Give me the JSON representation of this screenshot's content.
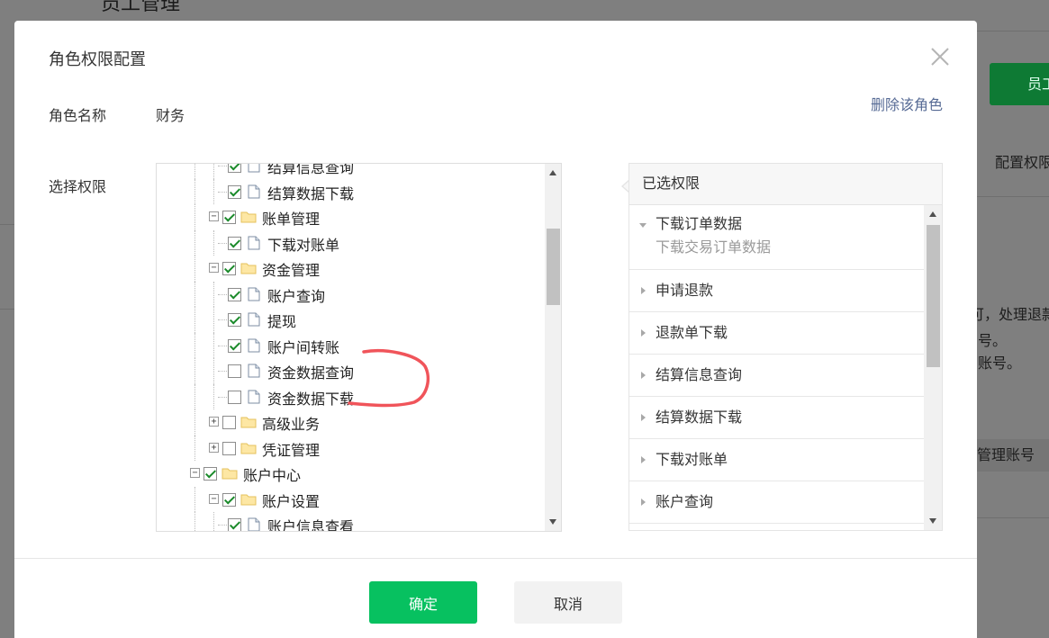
{
  "background": {
    "title": "员工管理",
    "button_label": "员工",
    "tab_label": "配置权限",
    "notice_line1": "可，处理退款",
    "notice_line2": "号。",
    "notice_line3": "账号。",
    "table_cell": "管理账号"
  },
  "dialog": {
    "title": "角色权限配置",
    "role_name_label": "角色名称",
    "role_name_value": "财务",
    "delete_role": "删除该角色",
    "select_permission_label": "选择权限",
    "confirm_label": "确定",
    "cancel_label": "取消"
  },
  "tree": {
    "nodes": [
      {
        "label": "结算信息查询",
        "level": 2,
        "type": "leaf",
        "checked": true
      },
      {
        "label": "结算数据下载",
        "level": 2,
        "type": "leaf",
        "checked": true
      },
      {
        "label": "账单管理",
        "level": 1,
        "type": "folder",
        "checked": true,
        "expanded": true
      },
      {
        "label": "下载对账单",
        "level": 2,
        "type": "leaf",
        "checked": true
      },
      {
        "label": "资金管理",
        "level": 1,
        "type": "folder",
        "checked": true,
        "expanded": true
      },
      {
        "label": "账户查询",
        "level": 2,
        "type": "leaf",
        "checked": true
      },
      {
        "label": "提现",
        "level": 2,
        "type": "leaf",
        "checked": true
      },
      {
        "label": "账户间转账",
        "level": 2,
        "type": "leaf",
        "checked": true
      },
      {
        "label": "资金数据查询",
        "level": 2,
        "type": "leaf",
        "checked": false
      },
      {
        "label": "资金数据下载",
        "level": 2,
        "type": "leaf",
        "checked": false
      },
      {
        "label": "高级业务",
        "level": 1,
        "type": "folder",
        "checked": false,
        "expanded": false
      },
      {
        "label": "凭证管理",
        "level": 1,
        "type": "folder",
        "checked": false,
        "expanded": false
      },
      {
        "label": "账户中心",
        "level": 0,
        "type": "folder",
        "checked": true,
        "expanded": true
      },
      {
        "label": "账户设置",
        "level": 1,
        "type": "folder",
        "checked": true,
        "expanded": true
      },
      {
        "label": "账户信息查看",
        "level": 2,
        "type": "leaf",
        "checked": true
      }
    ]
  },
  "selected": {
    "header": "已选权限",
    "items": [
      {
        "name": "下载订单数据",
        "desc": "下载交易订单数据",
        "open": true
      },
      {
        "name": "申请退款",
        "desc": "",
        "open": false
      },
      {
        "name": "退款单下载",
        "desc": "",
        "open": false
      },
      {
        "name": "结算信息查询",
        "desc": "",
        "open": false
      },
      {
        "name": "结算数据下载",
        "desc": "",
        "open": false
      },
      {
        "name": "下载对账单",
        "desc": "",
        "open": false
      },
      {
        "name": "账户查询",
        "desc": "",
        "open": false
      }
    ]
  },
  "colors": {
    "primary_green": "#07c160",
    "link_blue": "#576b95",
    "annotation_red": "#f0545a"
  },
  "icons": {
    "close": "close-icon",
    "folder": "folder-icon",
    "document": "document-icon"
  }
}
